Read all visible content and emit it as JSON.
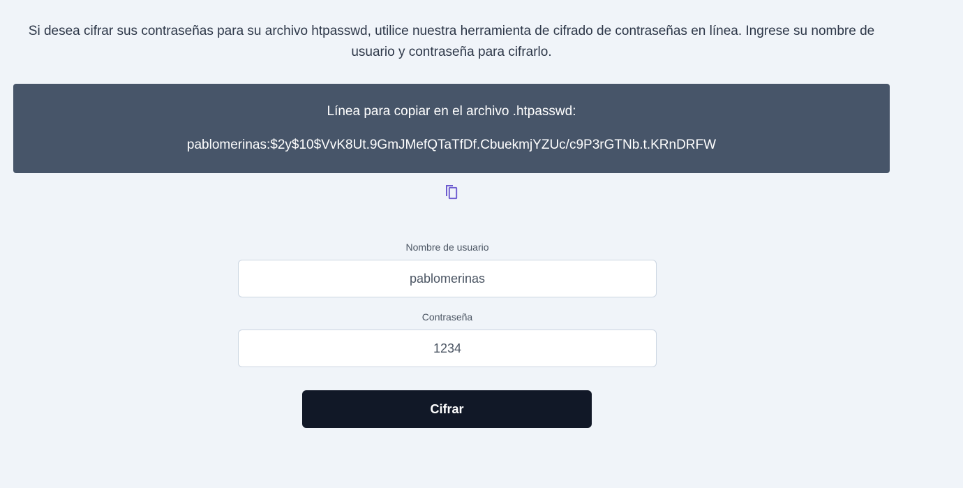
{
  "intro": {
    "text": "Si desea cifrar sus contraseñas para su archivo htpasswd, utilice nuestra herramienta de cifrado de contraseñas en línea. Ingrese su nombre de usuario y contraseña para cifrarlo."
  },
  "result": {
    "title": "Línea para copiar en el archivo .htpasswd:",
    "line": "pablomerinas:$2y$10$VvK8Ut.9GmJMefQTaTfDf.CbuekmjYZUc/c9P3rGTNb.t.KRnDRFW",
    "copy_icon": "copy-icon",
    "accent_color": "#6d5bd0",
    "background_color": "#475569"
  },
  "form": {
    "username": {
      "label": "Nombre de usuario",
      "value": "pablomerinas"
    },
    "password": {
      "label": "Contraseña",
      "value": "1234"
    },
    "submit_label": "Cifrar",
    "submit_color": "#111827"
  }
}
